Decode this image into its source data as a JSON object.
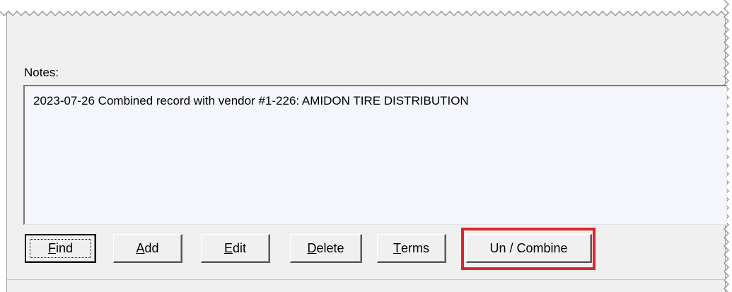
{
  "notes": {
    "label": "Notes:",
    "text": "2023-07-26 Combined record with vendor #1-226: AMIDON TIRE DISTRIBUTION"
  },
  "buttons": {
    "find": {
      "accel": "F",
      "rest": "ind"
    },
    "add": {
      "accel": "A",
      "rest": "dd"
    },
    "edit": {
      "accel": "E",
      "rest": "dit"
    },
    "delete": {
      "accel": "D",
      "rest": "elete"
    },
    "terms": {
      "accel": "T",
      "rest": "erms"
    },
    "uncombine": {
      "label": "Un / Combine"
    }
  },
  "colors": {
    "panel_background": "#f0f0f0",
    "notes_background": "#f4f6fb",
    "highlight": "#d9272e"
  }
}
